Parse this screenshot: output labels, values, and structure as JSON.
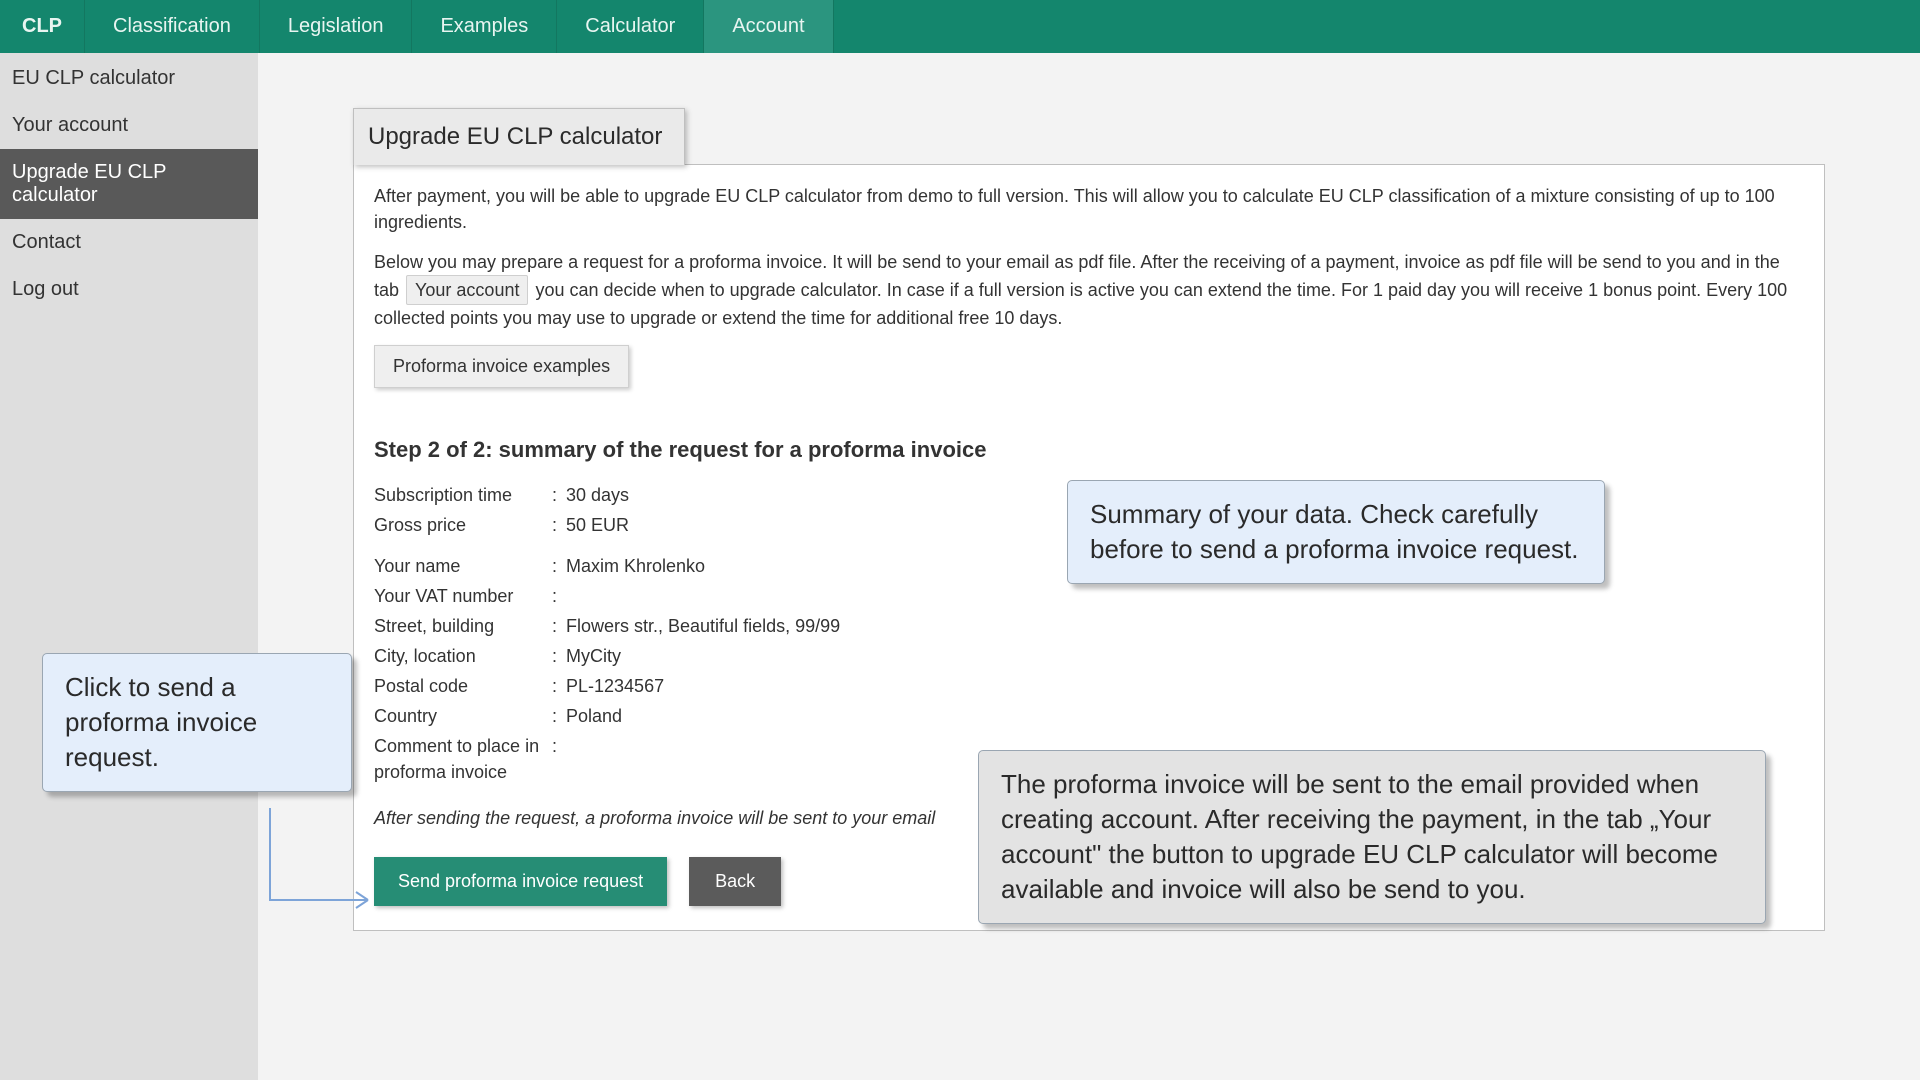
{
  "topnav": {
    "logo": "CLP",
    "items": [
      {
        "label": "Classification"
      },
      {
        "label": "Legislation"
      },
      {
        "label": "Examples"
      },
      {
        "label": "Calculator"
      },
      {
        "label": "Account"
      }
    ],
    "activeIndex": 4
  },
  "sidebar": {
    "items": [
      {
        "label": "EU CLP calculator"
      },
      {
        "label": "Your account"
      },
      {
        "label": "Upgrade EU CLP calculator"
      },
      {
        "label": "Contact"
      },
      {
        "label": "Log out"
      }
    ],
    "activeIndex": 2
  },
  "card": {
    "title": "Upgrade EU CLP calculator",
    "para1": "After payment, you will be able to upgrade EU CLP calculator from demo to full version. This will allow you to calculate EU CLP classification of a mixture consisting of up to 100 ingredients.",
    "para2a": "Below you may prepare a request for a proforma invoice. It will be send to your email as pdf file. After the receiving of a payment, invoice as pdf file will be send to you and in the tab",
    "inline_chip": "Your account",
    "para2b": "you can decide when to upgrade calculator. In case if a full version is active you can extend the time. For 1 paid day you will receive 1 bonus point. Every 100 collected points you may use to upgrade or extend the time for additional free 10 days.",
    "proforma_examples_btn": "Proforma invoice examples",
    "step_title": "Step 2 of 2: summary of the request for a proforma invoice",
    "rows_group1": [
      {
        "label": "Subscription time",
        "value": "30 days"
      },
      {
        "label": "Gross price",
        "value": "50 EUR"
      }
    ],
    "rows_group2": [
      {
        "label": "Your name",
        "value": "Maxim Khrolenko"
      },
      {
        "label": "Your VAT number",
        "value": ""
      },
      {
        "label": "Street, building",
        "value": "Flowers str., Beautiful fields, 99/99"
      },
      {
        "label": "City, location",
        "value": "MyCity"
      },
      {
        "label": "Postal code",
        "value": "PL-1234567"
      },
      {
        "label": "Country",
        "value": "Poland"
      },
      {
        "label": "Comment to place in proforma invoice",
        "value": ""
      }
    ],
    "italic_note": "After sending the request, a proforma invoice will be sent to your email",
    "send_btn": "Send proforma invoice request",
    "back_btn": "Back"
  },
  "callouts": {
    "left": "Click to send a proforma invoice request.",
    "right_top": "Summary of your data. Check carefully before to send a proforma invoice request.",
    "right_bottom": "The proforma invoice will be sent to the email provided when creating account. After receiving the payment, in the tab „Your account\" the button to upgrade EU CLP calculator will become available and invoice will also be send to you."
  }
}
